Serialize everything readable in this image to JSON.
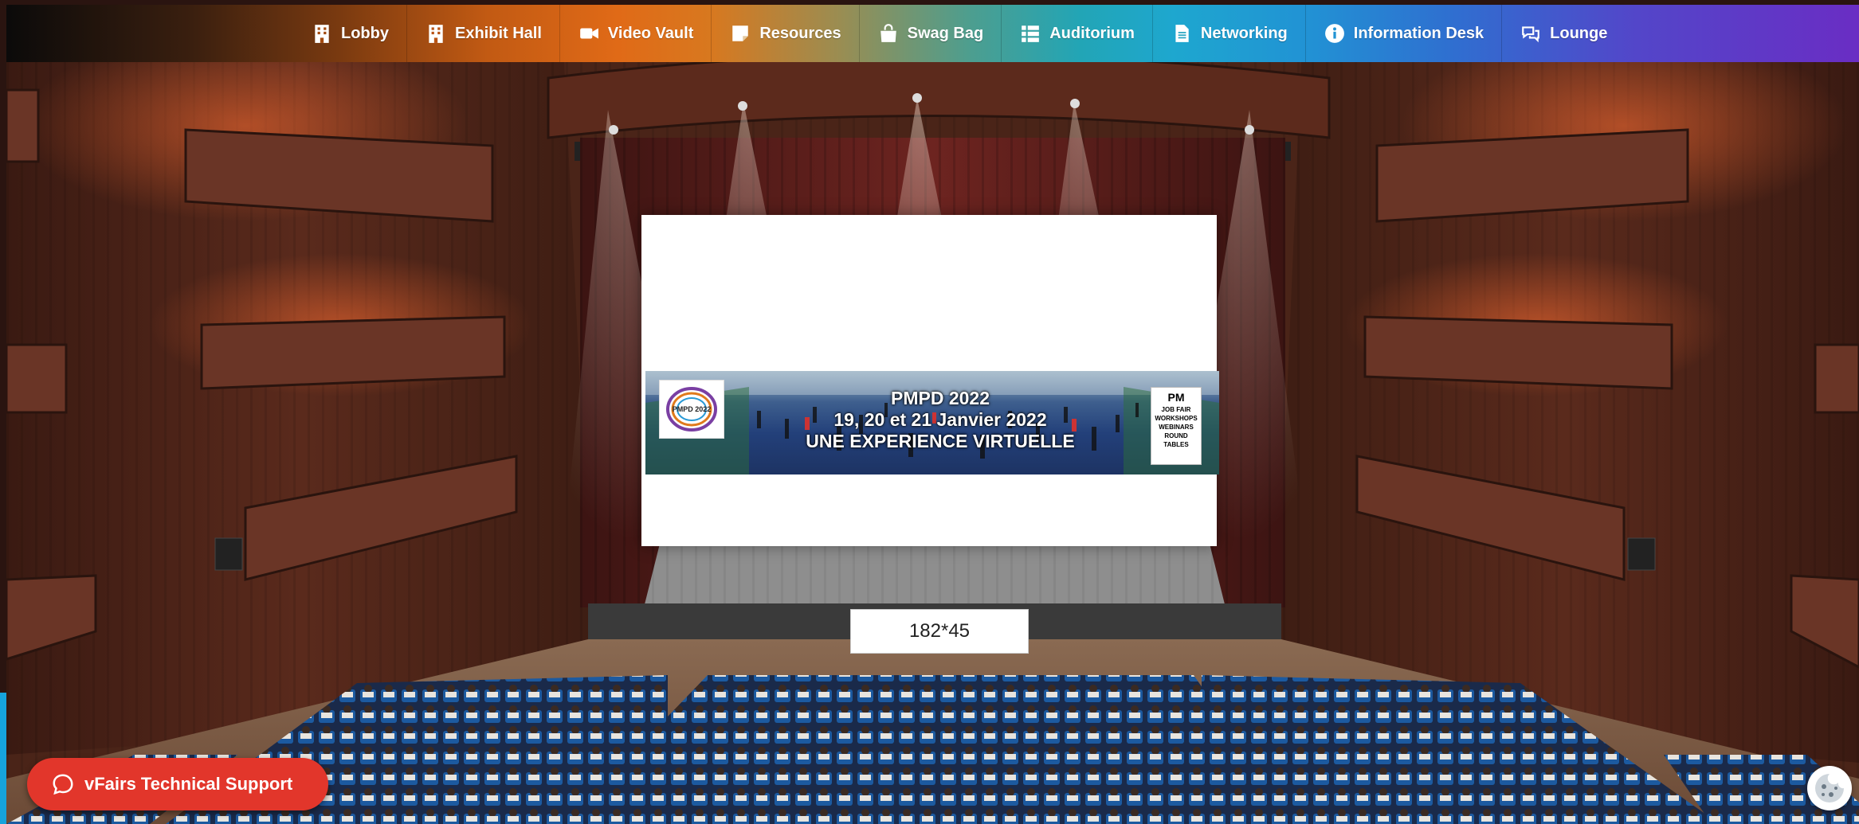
{
  "nav": {
    "items": [
      {
        "label": "Lobby",
        "icon": "building-icon"
      },
      {
        "label": "Exhibit Hall",
        "icon": "building-icon"
      },
      {
        "label": "Video Vault",
        "icon": "video-camera-icon"
      },
      {
        "label": "Resources",
        "icon": "sticky-note-icon"
      },
      {
        "label": "Swag Bag",
        "icon": "shopping-bag-icon"
      },
      {
        "label": "Auditorium",
        "icon": "list-icon"
      },
      {
        "label": "Networking",
        "icon": "document-icon"
      },
      {
        "label": "Information Desk",
        "icon": "info-circle-icon"
      },
      {
        "label": "Lounge",
        "icon": "chat-bubbles-icon"
      }
    ]
  },
  "screen": {
    "banner": {
      "line1": "PMPD 2022",
      "line2": "19, 20 et 21 Janvier 2022",
      "line3": "UNE EXPERIENCE VIRTUELLE",
      "logo_text": "PMPD 2022",
      "pm_title": "PM",
      "pm_list": [
        "JOB FAIR",
        "WORKSHOPS",
        "WEBINARS",
        "ROUND",
        "TABLES"
      ]
    }
  },
  "placard": {
    "text": "182*45"
  },
  "support": {
    "label": "vFairs Technical Support"
  },
  "colors": {
    "support_button": "#e2362b",
    "left_strip": "#16a3dc"
  }
}
